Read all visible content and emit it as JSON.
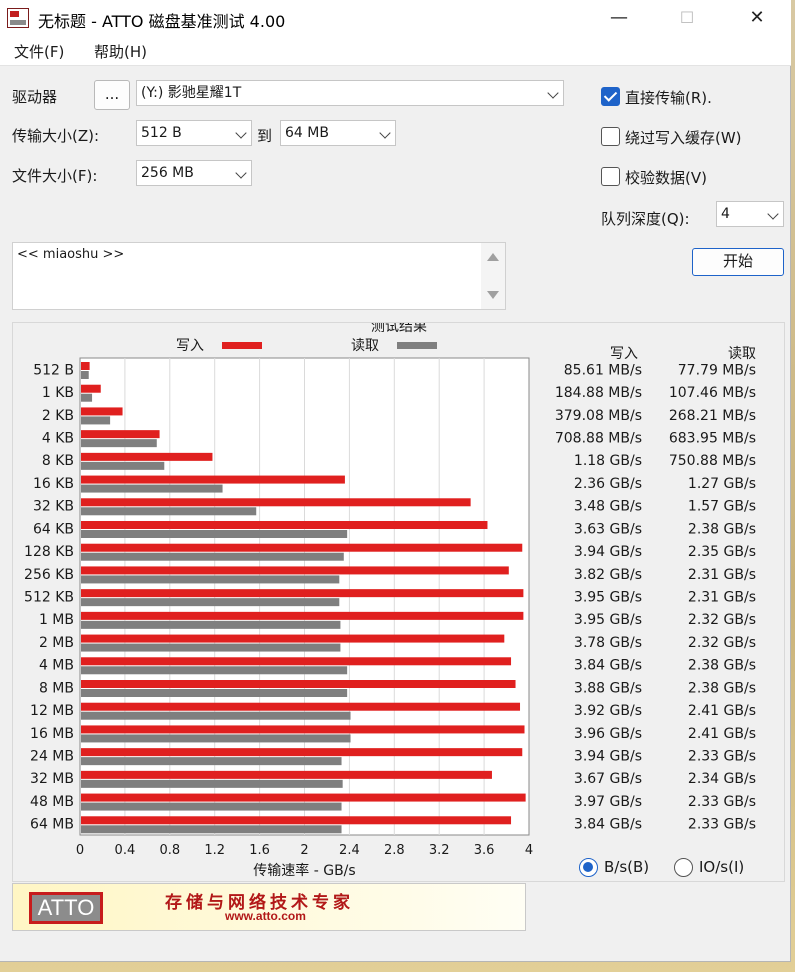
{
  "window": {
    "title": "无标题 - ATTO 磁盘基准测试 4.00",
    "minimize": "—",
    "maximize": "☐",
    "close": "✕"
  },
  "menu": [
    "文件(F)",
    "帮助(H)"
  ],
  "controls": {
    "drive_label": "驱动器",
    "browse_button": "...",
    "drive_value": "(Y:) 影驰星耀1T",
    "transfer_label": "传输大小(Z):",
    "transfer_from": "512 B",
    "to_label": "到",
    "transfer_to": "64 MB",
    "file_size_label": "文件大小(F):",
    "file_size": "256 MB",
    "direct_io": "直接传输(R).",
    "direct_io_checked": true,
    "bypass_cache": "绕过写入缓存(W)",
    "bypass_cache_checked": false,
    "verify": "校验数据(V)",
    "verify_checked": false,
    "queue_label": "队列深度(Q):",
    "queue_value": "4",
    "start_button": "开始",
    "description": "<< miaoshu >>"
  },
  "results": {
    "title": "测试结果",
    "legend_write": "写入",
    "legend_read": "读取",
    "col_write": "写入",
    "col_read": "读取",
    "write_text": [
      "85.61 MB/s",
      "184.88 MB/s",
      "379.08 MB/s",
      "708.88 MB/s",
      "1.18 GB/s",
      "2.36 GB/s",
      "3.48 GB/s",
      "3.63 GB/s",
      "3.94 GB/s",
      "3.82 GB/s",
      "3.95 GB/s",
      "3.95 GB/s",
      "3.78 GB/s",
      "3.84 GB/s",
      "3.88 GB/s",
      "3.92 GB/s",
      "3.96 GB/s",
      "3.94 GB/s",
      "3.67 GB/s",
      "3.97 GB/s",
      "3.84 GB/s"
    ],
    "read_text": [
      "77.79 MB/s",
      "107.46 MB/s",
      "268.21 MB/s",
      "683.95 MB/s",
      "750.88 MB/s",
      "1.27 GB/s",
      "1.57 GB/s",
      "2.38 GB/s",
      "2.35 GB/s",
      "2.31 GB/s",
      "2.31 GB/s",
      "2.32 GB/s",
      "2.32 GB/s",
      "2.38 GB/s",
      "2.38 GB/s",
      "2.41 GB/s",
      "2.41 GB/s",
      "2.33 GB/s",
      "2.34 GB/s",
      "2.33 GB/s",
      "2.33 GB/s"
    ],
    "unit_bs": "B/s(B)",
    "unit_io": "IO/s(I)",
    "unit_bs_selected": true
  },
  "banner": {
    "logo": "ATTO",
    "slogan": "存储与网络技术专家",
    "url": "www.atto.com"
  },
  "chart_data": {
    "type": "bar",
    "orientation": "horizontal",
    "categories": [
      "512 B",
      "1 KB",
      "2 KB",
      "4 KB",
      "8 KB",
      "16 KB",
      "32 KB",
      "64 KB",
      "128 KB",
      "256 KB",
      "512 KB",
      "1 MB",
      "2 MB",
      "4 MB",
      "8 MB",
      "12 MB",
      "16 MB",
      "24 MB",
      "32 MB",
      "48 MB",
      "64 MB"
    ],
    "series": [
      {
        "name": "写入",
        "color": "#e0201f",
        "values": [
          0.08561,
          0.18488,
          0.37908,
          0.70888,
          1.18,
          2.36,
          3.48,
          3.63,
          3.94,
          3.82,
          3.95,
          3.95,
          3.78,
          3.84,
          3.88,
          3.92,
          3.96,
          3.94,
          3.67,
          3.97,
          3.84
        ]
      },
      {
        "name": "读取",
        "color": "#7f7f7f",
        "values": [
          0.07779,
          0.10746,
          0.26821,
          0.68395,
          0.75088,
          1.27,
          1.57,
          2.38,
          2.35,
          2.31,
          2.31,
          2.32,
          2.32,
          2.38,
          2.38,
          2.41,
          2.41,
          2.33,
          2.34,
          2.33,
          2.33
        ]
      }
    ],
    "xlabel": "传输速率 - GB/s",
    "xlim": [
      0,
      4
    ],
    "xticks": [
      "0",
      "0.4",
      "0.8",
      "1.2",
      "1.6",
      "2",
      "2.4",
      "2.8",
      "3.2",
      "3.6",
      "4"
    ],
    "grid": true
  }
}
